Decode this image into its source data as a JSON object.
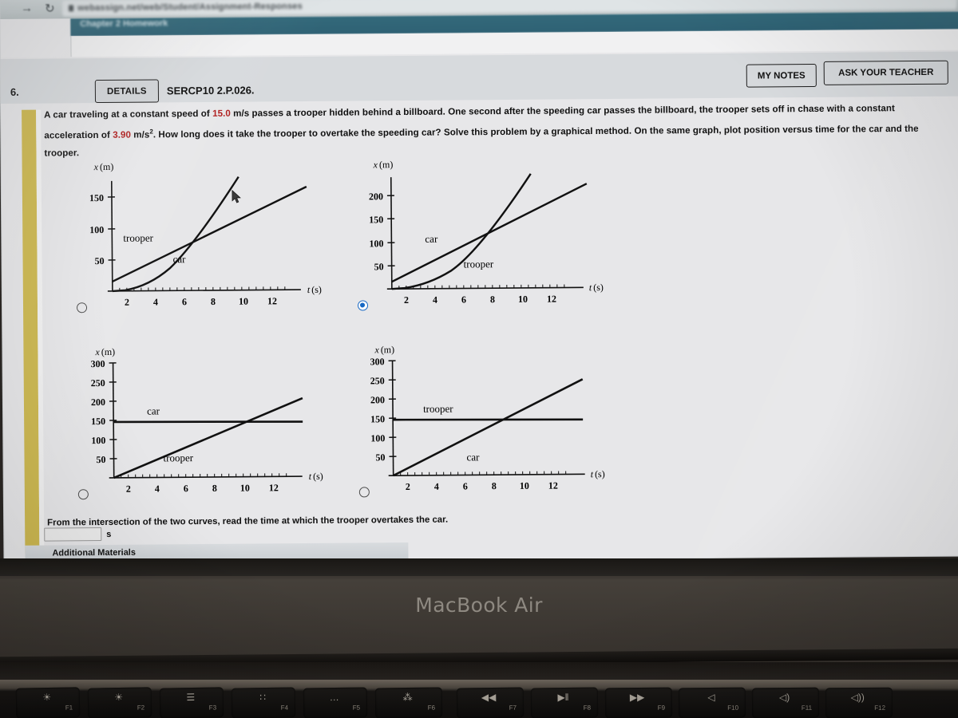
{
  "browser": {
    "back_icon": "back-arrow-icon",
    "reload_icon": "reload-icon",
    "url": "webassign.net/web/Student/Assignment-Responses",
    "site_band_text": "Chapter 2 Homework"
  },
  "header": {
    "question_number": "6.",
    "details_label": "DETAILS",
    "question_code": "SERCP10 2.P.026.",
    "my_notes_label": "MY NOTES",
    "ask_teacher_label": "ASK YOUR TEACHER"
  },
  "question": {
    "part1": "A car traveling at a constant speed of ",
    "speed": "15.0",
    "part2": " m/s passes a trooper hidden behind a billboard. One second after the speeding car passes the billboard, the trooper sets off in chase with a constant acceleration of ",
    "acceleration": "3.90",
    "part3": " m/s",
    "exponent": "2",
    "part4": ". How long does it take the trooper to overtake the speeding car? Solve this problem by a graphical method. On the same graph, plot position versus time for the car and the trooper."
  },
  "answer": {
    "prompt": "From the intersection of the two curves, read the time at which the trooper overtakes the car.",
    "value": "",
    "placeholder": "",
    "unit": "s"
  },
  "additional_materials": {
    "label": "Additional Materials"
  },
  "laptop": {
    "model": "MacBook Air",
    "function_keys": [
      {
        "label": "F1",
        "glyph": "☀",
        "name": "brightness-down-icon"
      },
      {
        "label": "F2",
        "glyph": "☀",
        "name": "brightness-up-icon"
      },
      {
        "label": "F3",
        "glyph": "☰",
        "name": "mission-control-icon"
      },
      {
        "label": "F4",
        "glyph": "∷",
        "name": "launchpad-icon"
      },
      {
        "label": "F5",
        "glyph": "…",
        "name": "keyboard-brightness-down-icon"
      },
      {
        "label": "F6",
        "glyph": "⁂",
        "name": "keyboard-brightness-up-icon"
      },
      {
        "label": "F7",
        "glyph": "◀◀",
        "name": "rewind-icon"
      },
      {
        "label": "F8",
        "glyph": "▶‖",
        "name": "play-pause-icon"
      },
      {
        "label": "F9",
        "glyph": "▶▶",
        "name": "fast-forward-icon"
      },
      {
        "label": "F10",
        "glyph": "◁",
        "name": "mute-icon"
      },
      {
        "label": "F11",
        "glyph": "◁)",
        "name": "volume-down-icon"
      },
      {
        "label": "F12",
        "glyph": "◁))",
        "name": "volume-up-icon"
      }
    ]
  },
  "chart_data": [
    {
      "id": "A",
      "type": "line",
      "selected": false,
      "xlabel": "t (s)",
      "ylabel": "x (m)",
      "xlim": [
        0,
        13.6
      ],
      "ylim": [
        0,
        175
      ],
      "xticks": [
        2,
        4,
        6,
        8,
        10,
        12
      ],
      "yticks": [
        50,
        100,
        150
      ],
      "grid": false,
      "series": [
        {
          "name": "trooper",
          "shape": "straight",
          "label_x": 2.6,
          "label_y": 72,
          "x": [
            0,
            13.6
          ],
          "y": [
            15,
            163
          ]
        },
        {
          "name": "car",
          "shape": "parabola",
          "label_x": 5.6,
          "label_y": 43,
          "x": [
            0,
            1,
            2,
            3,
            4,
            5,
            6,
            7,
            8,
            9.2
          ],
          "y": [
            0,
            0,
            2,
            9,
            20,
            35,
            54,
            77,
            105,
            142
          ]
        }
      ]
    },
    {
      "id": "B",
      "type": "line",
      "selected": true,
      "xlabel": "t (s)",
      "ylabel": "x (m)",
      "xlim": [
        0,
        13.6
      ],
      "ylim": [
        0,
        235
      ],
      "xticks": [
        2,
        4,
        6,
        8,
        10,
        12
      ],
      "yticks": [
        50,
        100,
        150,
        200
      ],
      "grid": false,
      "series": [
        {
          "name": "car",
          "shape": "straight",
          "label_x": 4.2,
          "label_y": 100,
          "x": [
            0,
            13.6
          ],
          "y": [
            15,
            219
          ]
        },
        {
          "name": "trooper",
          "shape": "parabola",
          "label_x": 6.6,
          "label_y": 46,
          "x": [
            0,
            1,
            2,
            3,
            4,
            5,
            6,
            7,
            8,
            9,
            10,
            11
          ],
          "y": [
            0,
            0,
            2,
            8,
            18,
            31,
            49,
            70,
            95,
            124,
            158,
            195
          ]
        }
      ]
    },
    {
      "id": "C",
      "type": "line",
      "selected": false,
      "xlabel": "t (s)",
      "ylabel": "x (m)",
      "xlim": [
        0,
        13.6
      ],
      "ylim": [
        0,
        300
      ],
      "xticks": [
        2,
        4,
        6,
        8,
        10,
        12
      ],
      "yticks": [
        50,
        100,
        150,
        200,
        250,
        300
      ],
      "grid": false,
      "series": [
        {
          "name": "car",
          "shape": "straight",
          "label_x": 4.1,
          "label_y": 175,
          "x": [
            0,
            13.6
          ],
          "y": [
            146,
            143
          ]
        },
        {
          "name": "trooper",
          "shape": "straight",
          "label_x": 5.3,
          "label_y": 42,
          "x": [
            0,
            13.6
          ],
          "y": [
            0,
            203
          ]
        }
      ]
    },
    {
      "id": "D",
      "type": "line",
      "selected": false,
      "xlabel": "t (s)",
      "ylabel": "x (m)",
      "xlim": [
        0,
        13.6
      ],
      "ylim": [
        0,
        300
      ],
      "xticks": [
        2,
        4,
        6,
        8,
        10,
        12
      ],
      "yticks": [
        50,
        100,
        150,
        200,
        250,
        300
      ],
      "grid": false,
      "series": [
        {
          "name": "trooper",
          "shape": "straight",
          "label_x": 4.0,
          "label_y": 178,
          "x": [
            0,
            13.6
          ],
          "y": [
            146,
            143
          ]
        },
        {
          "name": "car",
          "shape": "straight",
          "label_x": 6.1,
          "label_y": 44,
          "x": [
            0,
            13.6
          ],
          "y": [
            0,
            249
          ]
        }
      ]
    }
  ]
}
